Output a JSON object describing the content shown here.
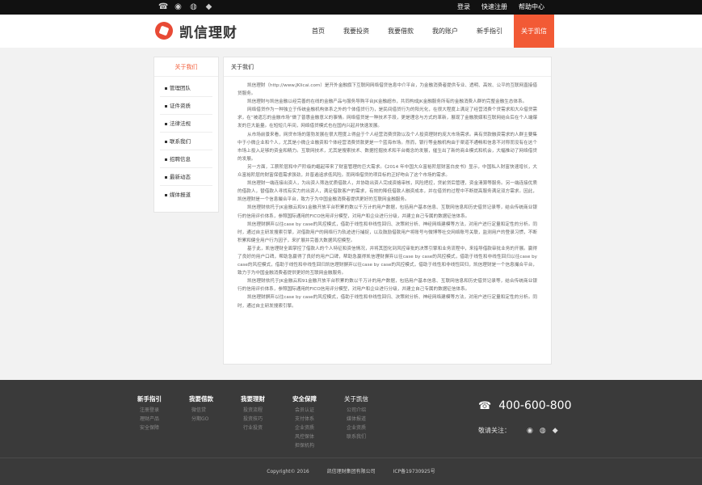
{
  "topbar": {
    "icons": [
      "phone-icon",
      "weibo-icon",
      "wechat-icon",
      "qq-icon"
    ],
    "links": [
      "登录",
      "快速注册",
      "帮助中心"
    ]
  },
  "header": {
    "logo_text": "凯信理财",
    "nav": [
      "首页",
      "我要投资",
      "我要借款",
      "我的账户",
      "新手指引",
      "关于凯信"
    ],
    "active_index": 5
  },
  "sidebar": {
    "title": "关于我们",
    "items": [
      "管理团队",
      "证件资质",
      "法律法规",
      "联系我们",
      "招聘信息",
      "最新动态",
      "媒体报道"
    ]
  },
  "content": {
    "title": "关于我们",
    "paragraphs": [
      "凯信理财（http://www.JKlicai.com）是开外金融旗下互联网网络借贷信息中介平台，为金融消费者提供专业、透明、高效、公平的互联网直接借贷服务。",
      "凯信理财与凯信金融以经完善的在线的金融产品与服务导购平台JK金融超市，共同构成JK金融服务所有的金融消费人群的完整金融生态体系。",
      "网络借贷作为一种独立于传统金融机构体系之外的个体借贷行为，是民间借贷行为的阳光化，在很大程度上满足了经营消费个贷需求和大众借贷需求，在“被遗忘的金融市场”做了普惠金融意义的事情。网络借贷是一种技术手段，更是理念与方式的革新，展现了金融脱媒和互联网结合后在个人端爆发的巨大能量。在短短几年间，网络借贷模式也在国内兴起并快速发展。",
      "从市场前景来看，网贷市场的蓬勃发展在很大程度上得益于个人经营消费贷款以及个人投资理财的庞大市场需求。具有贷款融资需求的人群主要集中于小微企业和个人，尤其是小微企业融资和个体经营消费贷款更是一个蓝海市场。然而，银行等金融机构由于渠道不通畅和信息不对称而没有在这个市场上投入足够的资金和精力。互联网技术，尤其是搜索技术、数据挖掘技术和平台概念的发展，催生出了新的商业模式和机会，大幅推动了网络借贷的发展。",
      "另一方面，工薪阶层和中产阶级的崛起带来了财富管理的巨大需求。《2014 年中国大众富裕阶层财富白皮书》显示，中国私人财富快速增长，大众富裕阶层的财富保值需求强劲，并普遍追求低风险。而网络借贷的项目标的正好吻合了这个市场的需求。",
      "凯信理财一端连接出资人，为出资人筛选优质借款人，并协助出资人完成资格审核，风险把控，贷前贷后管理，资金清算等服务。另一端连接优质的借款人，替借款人寻找有实力的出资人，满足借款客户的需求，有效的降低借款人融资成本，并在借贷的过程中不断提高服务满足双方需求。因此，凯信理财是一个信息撮合平台，致力于为中国金融消费者提供更好的互联网金融服务。",
      "凯信理财依托于JK金融云和91金融开放平台积累的数以千万计的用户数据，包括用户基本信息、互联网信息和历史借贷记录等，结合传统商业银行的信用评价体系，参照国际通用的FICO信用评分模型，对用户和企业进行分级，并建立自己专属的数据征信体系。",
      "凯信理财摒弃以往case by case的风控模式，借助于线性和非线性回归、决策树分析、神经网络建模等方法，对用户进行定量和定性的分析。同时，通过自主研发搜索引擎，对借款用户的网络行为轨迹进行捕捉，以及鼓励借款用户将账号与微博等社交网络账号关联，监测用户的登录习惯，不断积累和健全用户行为因子，来扩展并完善大数据风控模型。",
      "基于此，凯信理财全面掌控了借款人的个人特征和资信情况，并将其固化到风控审批的决策引擎和业务流程中，来指导借款审批业务的开展。赢得了良好的用户口碑，帮助急赢得了良好的用户口碑，帮助急赢得凯信理财摒弃以往case by case的风控模式，借助于线性和非线性回归以往case by case的风控模式，借助于线性和非线性回归凯信理财摒弃以往case by case的风控模式，借助于线性和非线性回归，凯信理财是一个信息撮合平台，致力于为中国金融消费者提供更好的互联网金融服务。",
      "凯信理财依托于JK金融云和91金融开放平台积累的数以千万计的用户数据，包括用户基本信息、互联网信息和历史借贷记录等，结合传统商业银行的信用评价体系，参照国际通用的FICO信用评分模型，对用户和企业进行分级，并建立自己专属的数据征信体系。",
      "凯信理财摒弃以往case by case的风控模式，借助于线性和非线性回归、决策树分析、神经网络建模等方法，对用户进行定量和定性的分析。同时，通过自主研发搜索引擎。"
    ]
  },
  "footer": {
    "columns": [
      {
        "title": "新手指引",
        "links": [
          "注册登录",
          "理财产品",
          "安全保障"
        ]
      },
      {
        "title": "我要借款",
        "links": [
          "微信贷",
          "分期GO"
        ]
      },
      {
        "title": "我要理财",
        "links": [
          "投资流程",
          "投资技巧",
          "行业投资"
        ]
      },
      {
        "title": "安全保障",
        "links": [
          "会员认证",
          "支付体系",
          "企业资质",
          "风控保体",
          "担保机构"
        ]
      },
      {
        "title": "关于凯信",
        "links": [
          "公司介绍",
          "媒体报道",
          "企业资质",
          "联系我们"
        ]
      }
    ],
    "hotline": "400-600-800",
    "follow_label": "敬请关注：",
    "follow_icons": [
      "weibo-icon",
      "wechat-icon",
      "qq-icon"
    ],
    "copyright": "Copyright© 2016",
    "company": "凯信理财集团有限公司",
    "icp": "ICP备19730925号"
  }
}
